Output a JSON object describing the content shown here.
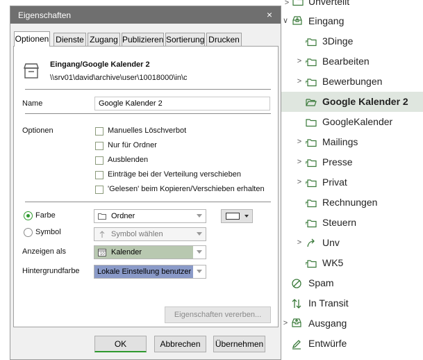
{
  "dialog": {
    "title": "Eigenschaften",
    "close_glyph": "×",
    "tabs": [
      "Optionen",
      "Dienste",
      "Zugang",
      "Publizieren",
      "Sortierung",
      "Drucken"
    ],
    "active_tab": "Optionen",
    "header": {
      "folder_title": "Eingang/Google Kalender 2",
      "folder_path": "\\\\srv01\\david\\archive\\user\\10018000\\in\\c"
    },
    "name_label": "Name",
    "name_value": "Google Kalender 2",
    "options_label": "Optionen",
    "checkboxes": [
      {
        "label": "Manuelles Löschverbot",
        "checked": false
      },
      {
        "label": "Nur für Ordner",
        "checked": false
      },
      {
        "label": "Ausblenden",
        "checked": false
      },
      {
        "label": "Einträge bei der Verteilung verschieben",
        "checked": false
      },
      {
        "label": "'Gelesen' beim Kopieren/Verschieben erhalten",
        "checked": false
      }
    ],
    "farbe_label": "Farbe",
    "symbol_label": "Symbol",
    "farbe_selected": true,
    "farbe_combo_value": "Ordner",
    "symbol_combo_value": "Symbol wählen",
    "anzeigen_label": "Anzeigen als",
    "anzeigen_value": "Kalender",
    "hintergrund_label": "Hintergrundfarbe",
    "hintergrund_value": "Lokale Einstellung benutzer",
    "vererben_button": "Eigenschaften vererben...",
    "ok_button": "OK",
    "abbrechen_button": "Abbrechen",
    "uebernehmen_button": "Übernehmen",
    "colors": {
      "titlebar": "#6f6f6f",
      "accent_green": "#2e9a2e",
      "calendar_bg": "#b8c8b0",
      "hintergrund_bg": "#8a9ac8"
    }
  },
  "tree": {
    "items": [
      {
        "label": "Unverteilt",
        "icon": "folder-icon",
        "expand": "none",
        "selected": false
      },
      {
        "label": "Eingang",
        "icon": "inbox-icon",
        "expand": "expanded",
        "selected": false
      },
      {
        "label": "3Dinge",
        "icon": "folder-link-icon",
        "expand": "none",
        "selected": false
      },
      {
        "label": "Bearbeiten",
        "icon": "folder-link-icon",
        "expand": "collapsed",
        "selected": false
      },
      {
        "label": "Bewerbungen",
        "icon": "folder-link-icon",
        "expand": "collapsed",
        "selected": false
      },
      {
        "label": "Google Kalender 2",
        "icon": "folder-open-icon",
        "expand": "none",
        "selected": true
      },
      {
        "label": "GoogleKalender",
        "icon": "folder-icon",
        "expand": "none",
        "selected": false
      },
      {
        "label": "Mailings",
        "icon": "folder-link-icon",
        "expand": "collapsed",
        "selected": false
      },
      {
        "label": "Presse",
        "icon": "folder-link-icon",
        "expand": "collapsed",
        "selected": false
      },
      {
        "label": "Privat",
        "icon": "folder-link-icon",
        "expand": "collapsed",
        "selected": false
      },
      {
        "label": "Rechnungen",
        "icon": "folder-link-icon",
        "expand": "none",
        "selected": false
      },
      {
        "label": "Steuern",
        "icon": "folder-link-icon",
        "expand": "none",
        "selected": false
      },
      {
        "label": "Unv",
        "icon": "redirect-icon",
        "expand": "collapsed",
        "selected": false
      },
      {
        "label": "WK5",
        "icon": "folder-link-icon",
        "expand": "none",
        "selected": false
      },
      {
        "label": "Spam",
        "icon": "spam-icon",
        "expand": "none",
        "selected": false
      },
      {
        "label": "In Transit",
        "icon": "transit-icon",
        "expand": "none",
        "selected": false
      },
      {
        "label": "Ausgang",
        "icon": "outbox-icon",
        "expand": "collapsed",
        "selected": false
      },
      {
        "label": "Entwürfe",
        "icon": "pen-icon",
        "expand": "none",
        "selected": false
      }
    ]
  }
}
